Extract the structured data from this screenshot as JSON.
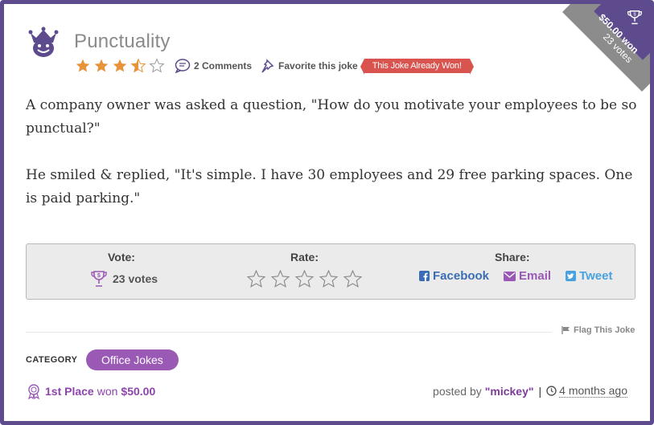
{
  "joke": {
    "title": "Punctuality",
    "rating_stars": 3,
    "comments_label": "2 Comments",
    "favorite_label": "Favorite this joke",
    "won_badge": "This Joke Already Won!",
    "paragraphs": [
      "A company owner was asked a question, \"How do you motivate your employees to be so punctual?\"",
      "He smiled & replied, \"It's simple. I have 30 employees and 29 free parking spaces. One is paid parking.\""
    ]
  },
  "corner": {
    "prize": "$50.00 won",
    "votes": "23 votes"
  },
  "panel": {
    "vote_title": "Vote:",
    "vote_count": "23 votes",
    "rate_title": "Rate:",
    "share_title": "Share:",
    "share_facebook": "Facebook",
    "share_email": "Email",
    "share_tweet": "Tweet"
  },
  "footer": {
    "flag_label": "Flag This Joke",
    "category_label": "CATEGORY",
    "category_value": "Office Jokes",
    "place": "1st Place",
    "won_text": "won",
    "won_amount": "$50.00",
    "posted_by": "posted by",
    "author": "\"mickey\"",
    "separator": "|",
    "time_ago": "4 months ago"
  },
  "colors": {
    "border": "#5d4b8e",
    "accent": "#9b59b6",
    "star": "#e8923a",
    "badge": "#d9534f",
    "share_blue": "#3a87c8"
  }
}
